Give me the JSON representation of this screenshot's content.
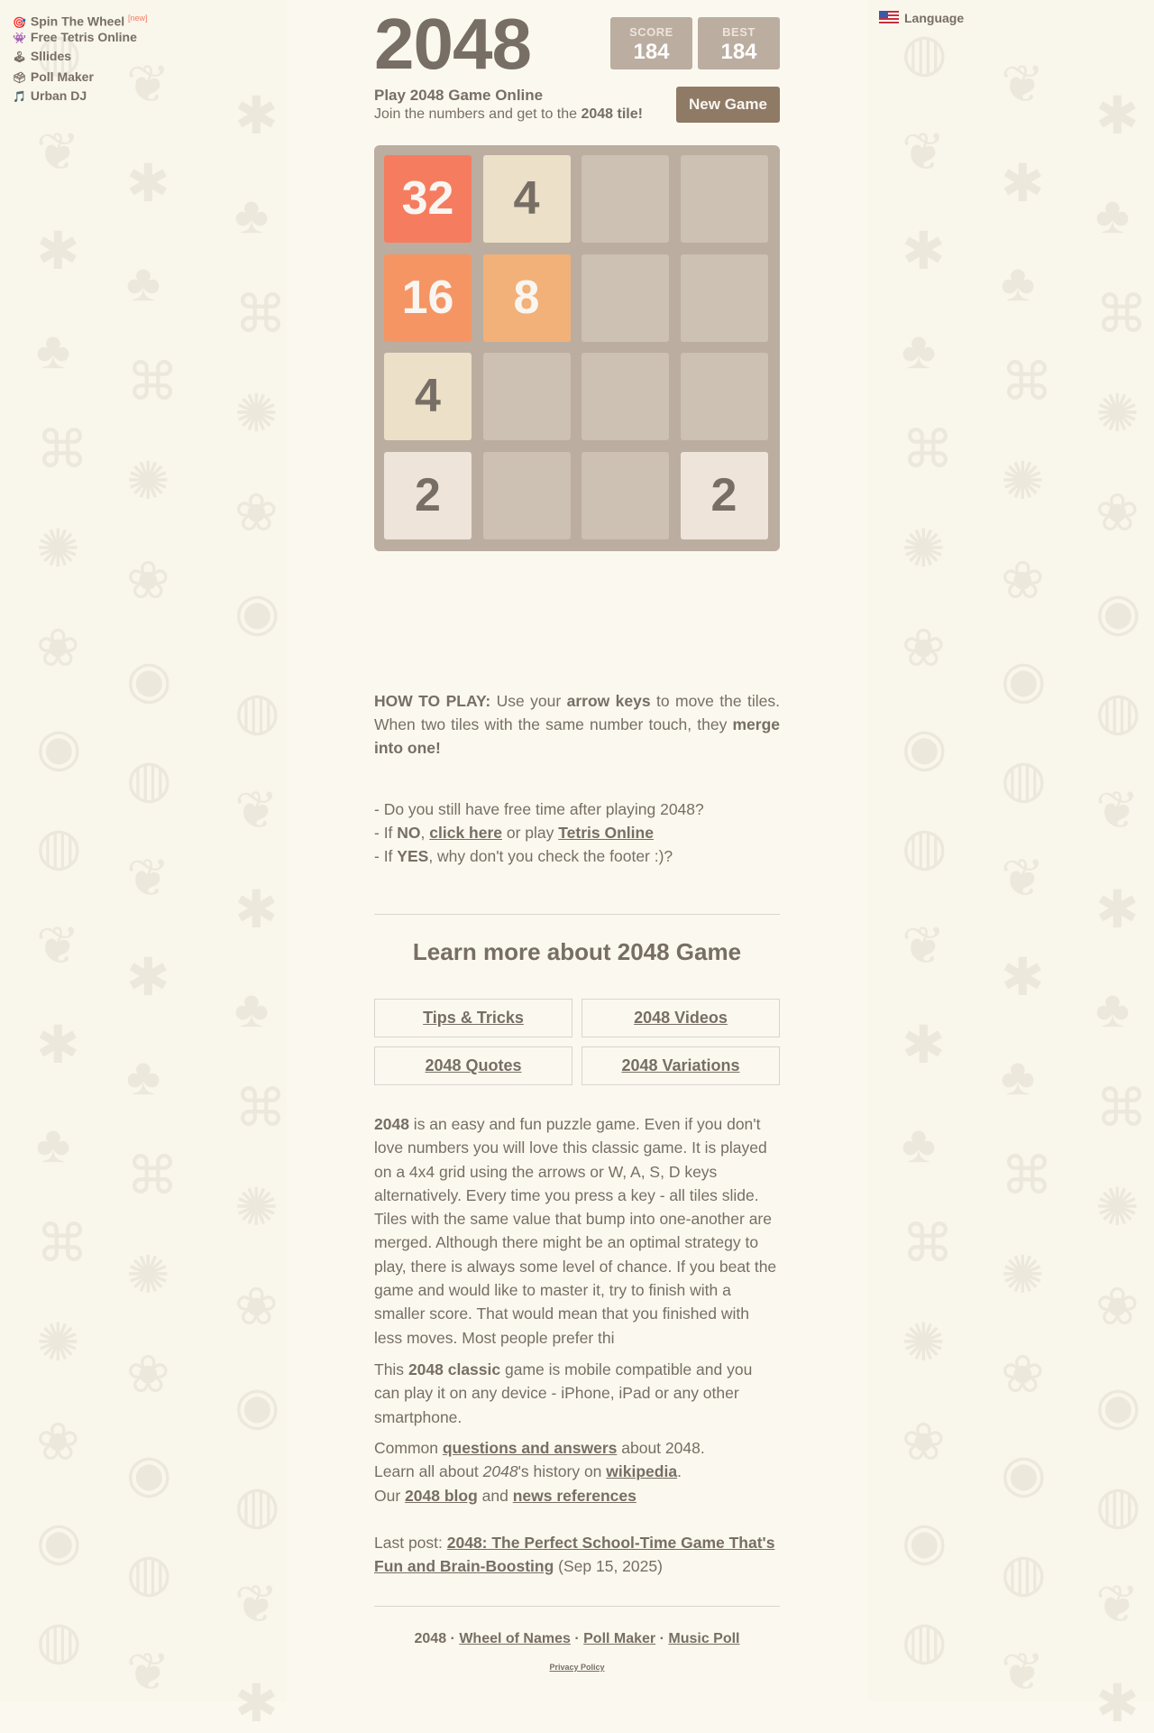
{
  "sidebar": {
    "links": [
      {
        "icon": "target-icon",
        "glyph": "🎯",
        "label": "Spin The Wheel",
        "badge": "[new]"
      },
      {
        "icon": "alien-icon",
        "glyph": "👾",
        "label": "Free Tetris Online"
      },
      {
        "icon": "joystick-icon",
        "glyph": "🕹",
        "label": "Sllides"
      },
      {
        "icon": "ballot-box-icon",
        "glyph": "🗳",
        "label": "Poll Maker"
      },
      {
        "icon": "music-note-icon",
        "glyph": "🎵",
        "label": "Urban DJ"
      }
    ]
  },
  "language": {
    "label": "Language",
    "icon": "us-flag-icon"
  },
  "header": {
    "title": "2048",
    "score_label": "SCORE",
    "score": "184",
    "best_label": "BEST",
    "best": "184",
    "subtitle": "Play 2048 Game Online",
    "intro_prefix": "Join the numbers and get to the ",
    "intro_bold": "2048 tile!",
    "new_game": "New Game"
  },
  "board": {
    "grid": [
      [
        32,
        4,
        null,
        null
      ],
      [
        16,
        8,
        null,
        null
      ],
      [
        4,
        null,
        null,
        null
      ],
      [
        2,
        null,
        null,
        2
      ]
    ]
  },
  "how_to": {
    "label": "HOW TO PLAY:",
    "t1": " Use your ",
    "keys": "arrow keys",
    "t2": " to move the tiles. When two tiles with the same number touch, they ",
    "merge": "merge into one!"
  },
  "faq": {
    "line1": "- Do you still have free time after playing 2048?",
    "line2_prefix": "- If ",
    "no": "NO",
    "line2_sep": ", ",
    "click_here": "click here",
    "line2_mid": " or play ",
    "tetris": "Tetris Online",
    "line3_prefix": "- If ",
    "yes": "YES",
    "line3_rest": ", why don't you check the footer :)?"
  },
  "learn": {
    "heading": "Learn more about 2048 Game",
    "buttons": [
      "Tips & Tricks",
      "2048 Videos",
      "2048 Quotes",
      "2048 Variations"
    ]
  },
  "about": {
    "p1_bold": "2048",
    "p1": " is an easy and fun puzzle game. Even if you don't love numbers you will love this classic game. It is played on a 4x4 grid using the arrows or W, A, S, D keys alternatively. Every time you press a key - all tiles slide. Tiles with the same value that bump into one-another are merged. Although there might be an optimal strategy to play, there is always some level of chance. If you beat the game and would like to master it, try to finish with a smaller score. That would mean that you finished with less moves. Most people prefer thi",
    "p2_a": "This ",
    "p2_bold": "2048 classic",
    "p2_b": " game is mobile compatible and you can play it on any device - iPhone, iPad or any other smartphone.",
    "p3_a": "Common ",
    "p3_link": "questions and answers",
    "p3_b": " about 2048.",
    "p4_a": "Learn all about ",
    "p4_i": "2048",
    "p4_b": "'s history on ",
    "p4_link": "wikipedia",
    "p4_c": ".",
    "p5_a": "Our ",
    "p5_link1": "2048 blog",
    "p5_b": " and ",
    "p5_link2": "news references",
    "last_label": "Last post: ",
    "last_link": "2048: The Perfect School-Time Game That's Fun and Brain-Boosting",
    "last_date": " (Sep 15, 2025)"
  },
  "footer": {
    "brand": "2048",
    "dot": " · ",
    "links": [
      "Wheel of Names",
      "Poll Maker",
      "Music Poll"
    ],
    "privacy": "Privacy Policy"
  },
  "colors": {
    "tile_2": "#eee4da",
    "tile_4": "#ede0c8",
    "tile_8": "#f2b179",
    "tile_16": "#f59563",
    "tile_32": "#f67c5f",
    "dark_text": "#776e65",
    "light_text": "#f9f6f2"
  }
}
